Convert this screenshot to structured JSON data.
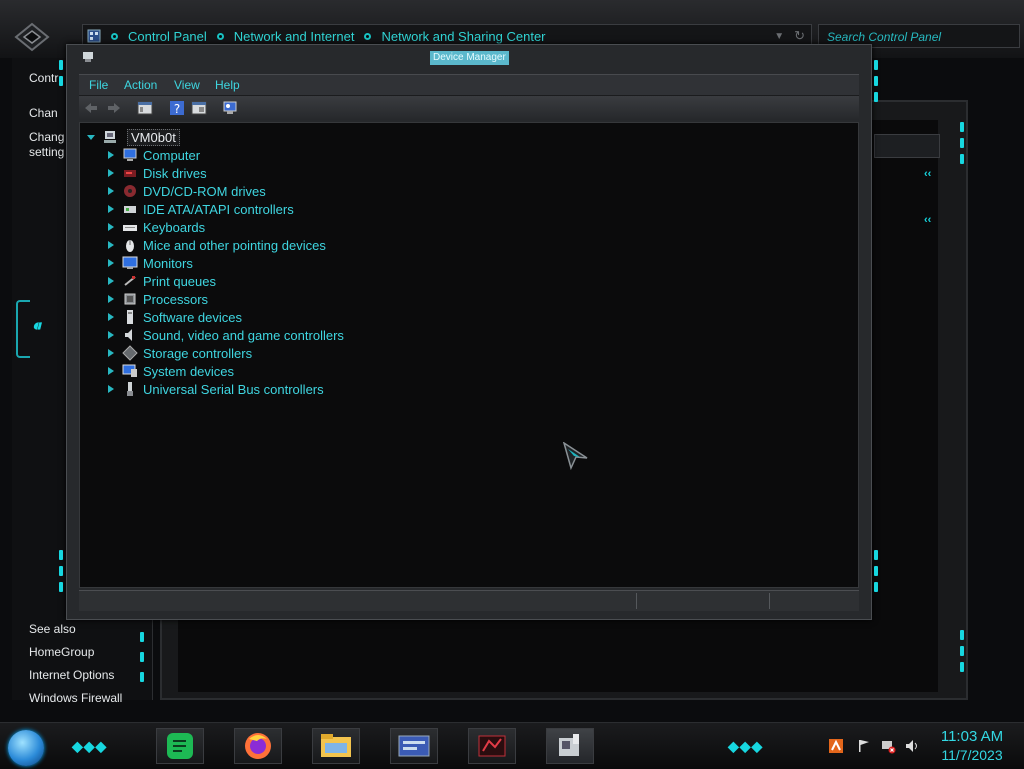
{
  "control_panel": {
    "breadcrumb": [
      "Control Panel",
      "Network and Internet",
      "Network and Sharing Center"
    ],
    "search_placeholder": "Search Control Panel",
    "left_pane": {
      "items": [
        "Contr",
        "Chan",
        "Chang",
        "setting"
      ],
      "see_also_heading": "See also",
      "see_also": [
        "HomeGroup",
        "Internet Options",
        "Windows Firewall"
      ]
    }
  },
  "device_manager": {
    "title": "Device Manager",
    "menu": [
      "File",
      "Action",
      "View",
      "Help"
    ],
    "toolbar_icons": [
      "back-icon",
      "forward-icon",
      "show-hide-console-tree-icon",
      "help-icon",
      "properties-icon",
      "scan-hardware-icon"
    ],
    "root": "VM0b0t",
    "devices": [
      {
        "label": "Computer",
        "icon": "computer-icon"
      },
      {
        "label": "Disk drives",
        "icon": "disk-drive-icon"
      },
      {
        "label": "DVD/CD-ROM drives",
        "icon": "dvd-drive-icon"
      },
      {
        "label": "IDE ATA/ATAPI controllers",
        "icon": "ide-controller-icon"
      },
      {
        "label": "Keyboards",
        "icon": "keyboard-icon"
      },
      {
        "label": "Mice and other pointing devices",
        "icon": "mouse-icon"
      },
      {
        "label": "Monitors",
        "icon": "monitor-icon"
      },
      {
        "label": "Print queues",
        "icon": "printer-icon"
      },
      {
        "label": "Processors",
        "icon": "processor-icon"
      },
      {
        "label": "Software devices",
        "icon": "software-device-icon"
      },
      {
        "label": "Sound, video and game controllers",
        "icon": "speaker-icon"
      },
      {
        "label": "Storage controllers",
        "icon": "storage-controller-icon"
      },
      {
        "label": "System devices",
        "icon": "system-device-icon"
      },
      {
        "label": "Universal Serial Bus controllers",
        "icon": "usb-icon"
      }
    ]
  },
  "taskbar": {
    "apps": [
      "notes-app-icon",
      "firefox-icon",
      "file-explorer-icon",
      "control-panel-icon",
      "red-app-icon",
      "device-manager-icon"
    ],
    "time": "11:03 AM",
    "date": "11/7/2023"
  },
  "colors": {
    "accent": "#3fd6e1",
    "title_highlight": "#5bb8cc"
  }
}
